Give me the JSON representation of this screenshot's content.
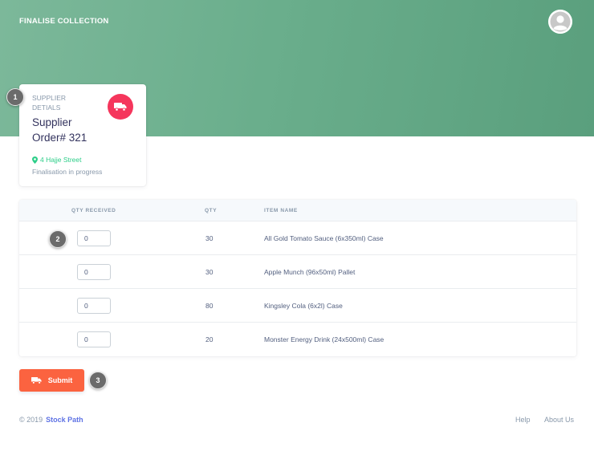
{
  "header": {
    "title": "FINALISE COLLECTION"
  },
  "card": {
    "label": "SUPPLIER DETIALS",
    "title": "Supplier Order# 321",
    "address": "4 Hajje Street",
    "status": "Finalisation in progress",
    "icon": "truck-icon",
    "icon_color": "#f5365c"
  },
  "table": {
    "headers": {
      "qty_received": "QTY RECEIVED",
      "qty": "QTY",
      "item_name": "ITEM NAME"
    },
    "rows": [
      {
        "qty_received": "0",
        "qty": "30",
        "item_name": "All Gold Tomato Sauce (6x350ml) Case"
      },
      {
        "qty_received": "0",
        "qty": "30",
        "item_name": "Apple Munch (96x50ml) Pallet"
      },
      {
        "qty_received": "0",
        "qty": "80",
        "item_name": "Kingsley Cola (6x2l) Case"
      },
      {
        "qty_received": "0",
        "qty": "20",
        "item_name": "Monster Energy Drink (24x500ml) Case"
      }
    ]
  },
  "submit": {
    "label": "Submit",
    "color": "#fb6340"
  },
  "badges": [
    "1",
    "2",
    "3"
  ],
  "footer": {
    "copyright": "© 2019",
    "brand": "Stock Path",
    "links": [
      "Help",
      "About Us"
    ]
  },
  "colors": {
    "header_gradient": [
      "#7cb89a",
      "#5a9f7d"
    ],
    "accent": "#2dce89"
  }
}
